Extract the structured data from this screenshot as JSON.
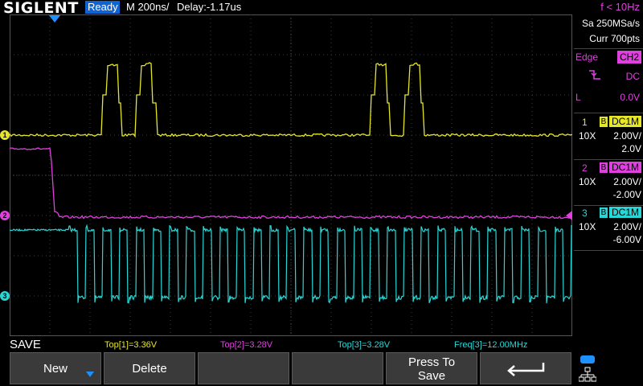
{
  "header": {
    "brand": "SIGLENT",
    "status": "Ready",
    "timebase": "M 200ns/",
    "delay": "Delay:-1.17us",
    "trigger_freq": "f < 10Hz"
  },
  "acquisition": {
    "sample_rate": "Sa 250MSa/s",
    "memory": "Curr 700pts"
  },
  "trigger": {
    "type": "Edge",
    "source": "CH2",
    "slope_icon": "falling-edge-icon",
    "coupling": "DC",
    "level_label": "L",
    "level": "0.0V"
  },
  "channels": [
    {
      "num": "1",
      "bw": "B",
      "coupling": "DC1M",
      "probe": "10X",
      "scale": "2.00V/",
      "offset": "2.0V",
      "color": "#e6e629",
      "marker": "1"
    },
    {
      "num": "2",
      "bw": "B",
      "coupling": "DC1M",
      "probe": "10X",
      "scale": "2.00V/",
      "offset": "-2.00V",
      "color": "#e040e0",
      "marker": "2"
    },
    {
      "num": "3",
      "bw": "B",
      "coupling": "DC1M",
      "probe": "10X",
      "scale": "2.00V/",
      "offset": "-6.00V",
      "color": "#29d6d6",
      "marker": "3"
    }
  ],
  "measurements": {
    "top1": "Top[1]=3.36V",
    "top2": "Top[2]=3.28V",
    "top3": "Top[3]=3.28V",
    "freq3": "Freq[3]=12.00MHz"
  },
  "menu": {
    "title": "SAVE",
    "new_label": "New",
    "delete_label": "Delete",
    "press_to_save_line1": "Press To",
    "press_to_save_line2": "Save",
    "back_icon": "return-arrow-icon"
  },
  "colors": {
    "ch1": "#e6e629",
    "ch2": "#e040e0",
    "ch3": "#29d6d6",
    "accent": "#1e90ff"
  }
}
